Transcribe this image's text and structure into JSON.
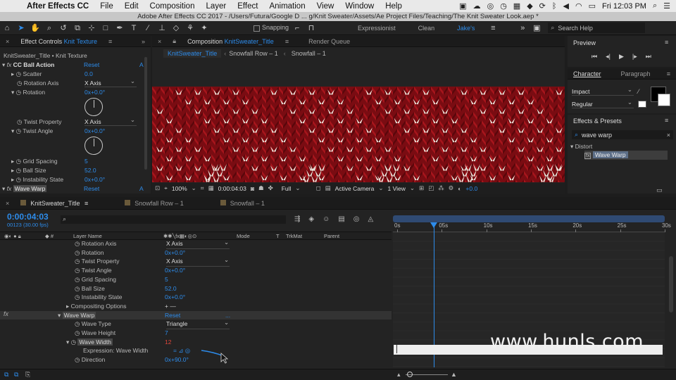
{
  "menubar": {
    "items": [
      "After Effects CC",
      "File",
      "Edit",
      "Composition",
      "Layer",
      "Effect",
      "Animation",
      "View",
      "Window",
      "Help"
    ],
    "clock": "Fri 12:03 PM"
  },
  "window_title": "Adobe After Effects CC 2017 - /Users/Futura/Google D ... g/Knit Sweater/Assets/Ae Project Files/Teaching/The Knit Sweater Look.aep *",
  "toolbar": {
    "snapping_label": "Snapping",
    "workspaces": [
      "Expressionist",
      "Clean",
      "Jake's"
    ],
    "search_placeholder": "Search Help"
  },
  "effect_controls": {
    "tab_label": "Effect Controls",
    "tab_layer": "Knit Texture",
    "breadcrumb": "KnitSweater_Title • Knit Texture",
    "effect1": {
      "name": "CC Ball Action",
      "reset": "Reset",
      "about": "A"
    },
    "props": [
      {
        "label": "Scatter",
        "value": "0.0"
      },
      {
        "label": "Rotation Axis",
        "value": "X Axis"
      },
      {
        "label": "Rotation",
        "value": "0x+0.0°"
      },
      {
        "label": "Twist Property",
        "value": "X Axis"
      },
      {
        "label": "Twist Angle",
        "value": "0x+0.0°"
      },
      {
        "label": "Grid Spacing",
        "value": "5"
      },
      {
        "label": "Ball Size",
        "value": "52.0"
      },
      {
        "label": "Instability State",
        "value": "0x+0.0°"
      }
    ],
    "effect2": {
      "name": "Wave Warp",
      "reset": "Reset",
      "about": "A"
    }
  },
  "composition": {
    "tab_label": "Composition",
    "tab_name": "KnitSweater_Title",
    "render_queue": "Render Queue",
    "nav": [
      "KnitSweater_Title",
      "Snowfall Row – 1",
      "Snowfall – 1"
    ],
    "footer": {
      "zoom": "100%",
      "timecode": "0:00:04:03",
      "resolution": "Full",
      "camera": "Active Camera",
      "views": "1 View",
      "exposure": "+0.0"
    }
  },
  "preview": {
    "title": "Preview"
  },
  "character": {
    "tab1": "Character",
    "tab2": "Paragraph",
    "font": "Impact",
    "style": "Regular"
  },
  "effects_presets": {
    "title": "Effects & Presets",
    "search_value": "wave warp",
    "category": "Distort",
    "result": "Wave Warp"
  },
  "timeline": {
    "tabs": [
      "KnitSweater_Title",
      "Snowfall Row – 1",
      "Snowfall – 1"
    ],
    "timecode": "0:00:04:03",
    "frame_info": "00123 (30.00 fps)",
    "columns": {
      "layer_name": "Layer Name",
      "mode": "Mode",
      "t": "T",
      "trkmat": "TrkMat",
      "parent": "Parent"
    },
    "rows": [
      {
        "label": "Rotation Axis",
        "value": "X Axis",
        "kind": "select"
      },
      {
        "label": "Rotation",
        "value": "0x+0.0°",
        "kind": "value"
      },
      {
        "label": "Twist Property",
        "value": "X Axis",
        "kind": "select"
      },
      {
        "label": "Twist Angle",
        "value": "0x+0.0°",
        "kind": "value"
      },
      {
        "label": "Grid Spacing",
        "value": "5",
        "kind": "value"
      },
      {
        "label": "Ball Size",
        "value": "52.0",
        "kind": "value"
      },
      {
        "label": "Instability State",
        "value": "0x+0.0°",
        "kind": "value"
      },
      {
        "label": "Compositing Options",
        "value": "+ —",
        "kind": "plain"
      },
      {
        "label": "Wave Warp",
        "value": "Reset",
        "kind": "effect",
        "extra": "..."
      },
      {
        "label": "Wave Type",
        "value": "Triangle",
        "kind": "select"
      },
      {
        "label": "Wave Height",
        "value": "7",
        "kind": "value"
      },
      {
        "label": "Wave Width",
        "value": "12",
        "kind": "red"
      },
      {
        "label": "Expression: Wave Width",
        "value": "",
        "kind": "expr"
      },
      {
        "label": "Direction",
        "value": "0x+90.0°",
        "kind": "value"
      }
    ],
    "ruler": [
      "0s",
      "05s",
      "10s",
      "15s",
      "20s",
      "25s",
      "30s"
    ],
    "playhead_seconds": 4.1,
    "duration_seconds": 30
  },
  "fx_label": "fx",
  "watermark": "www.hunls.com"
}
